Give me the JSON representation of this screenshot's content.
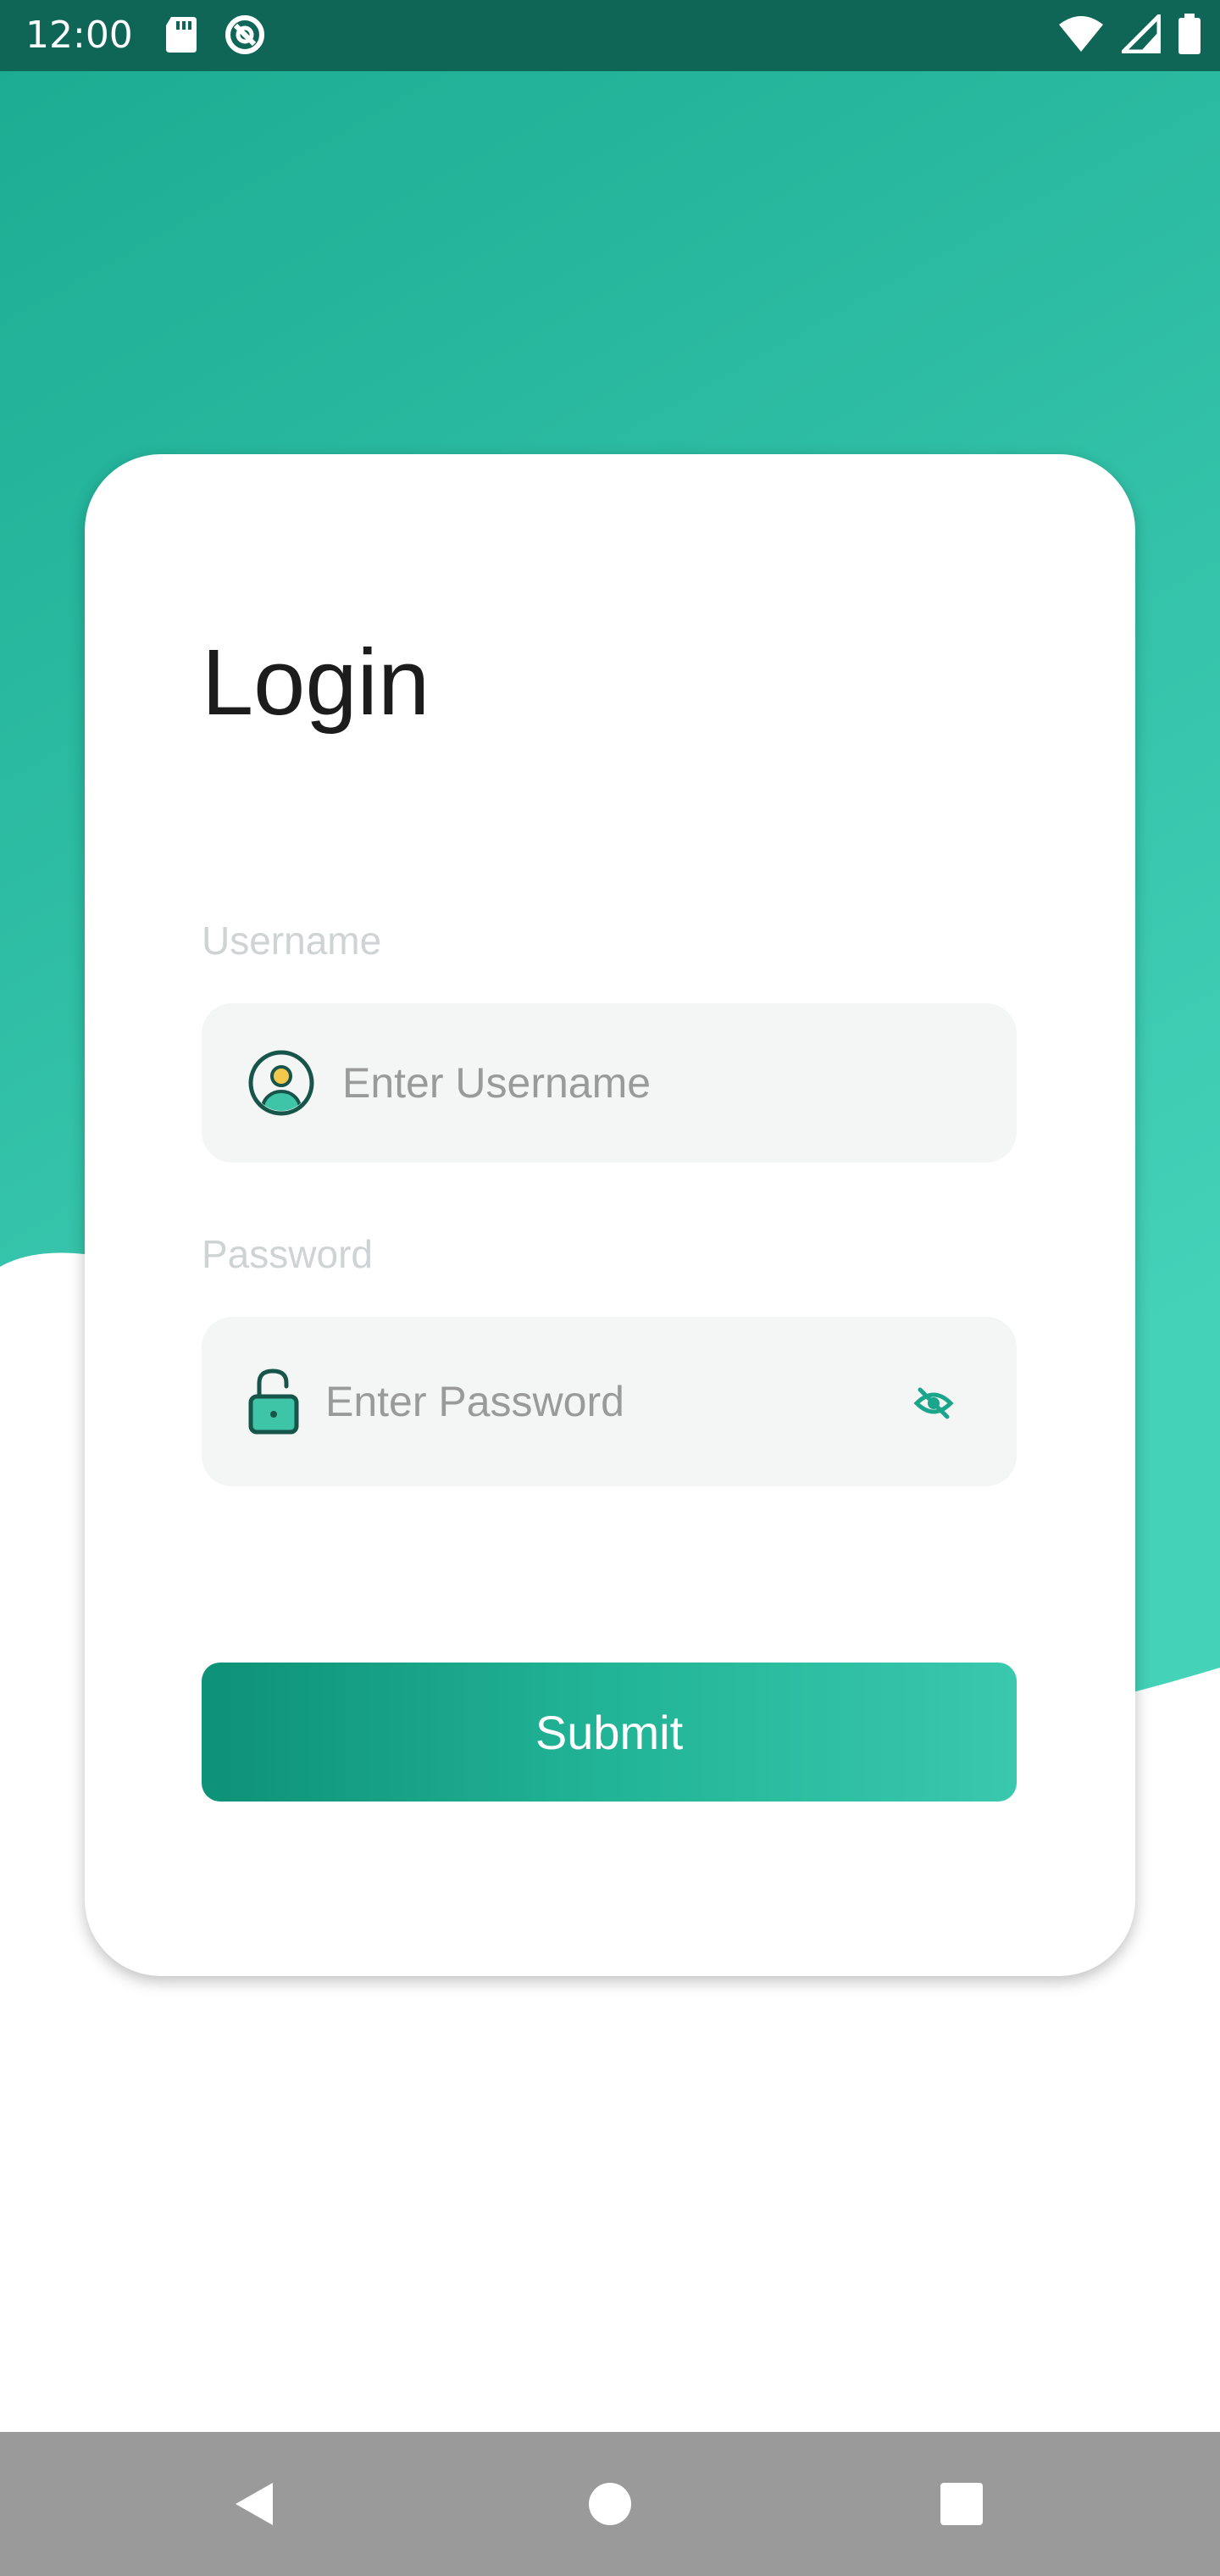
{
  "status_bar": {
    "time": "12:00",
    "icons": [
      "sd-card-icon",
      "do-not-disturb-icon",
      "wifi-icon",
      "signal-icon",
      "battery-icon"
    ]
  },
  "login": {
    "title": "Login",
    "username": {
      "label": "Username",
      "placeholder": "Enter Username",
      "value": ""
    },
    "password": {
      "label": "Password",
      "placeholder": "Enter Password",
      "value": ""
    },
    "submit_label": "Submit"
  },
  "nav_bar": {
    "buttons": [
      "back",
      "home",
      "recents"
    ]
  },
  "colors": {
    "status_bar": "#0f6657",
    "gradient_top": "#1aab92",
    "gradient_bottom": "#44d2b9",
    "accent": "#1aa58c",
    "card": "#ffffff",
    "input_bg": "#f4f6f5",
    "label": "#cfd3d4",
    "nav_bar": "#9a9a9a"
  }
}
